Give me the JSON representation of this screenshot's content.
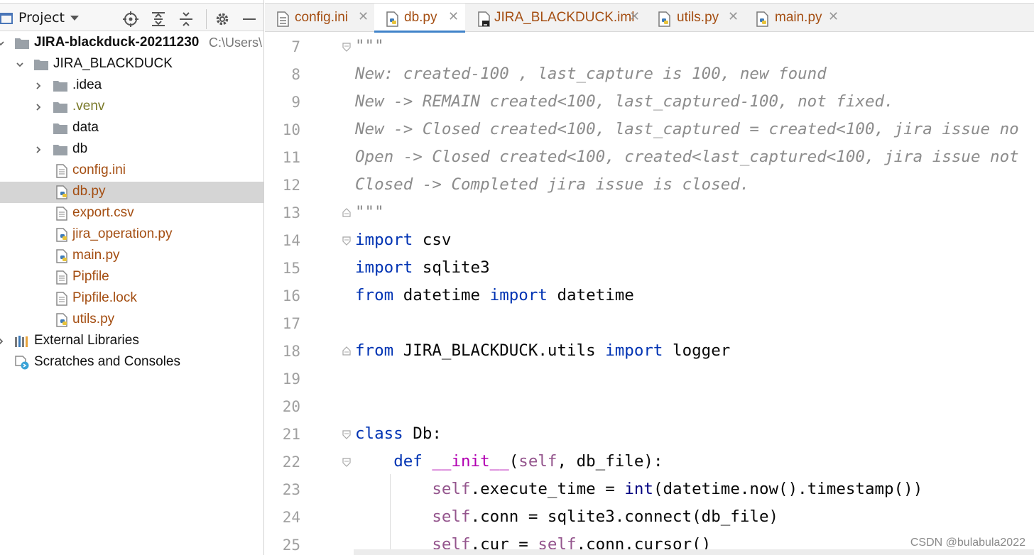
{
  "project_panel": {
    "title": "Project",
    "toolbar_icons": [
      "locate-icon",
      "expand-all-icon",
      "collapse-all-icon",
      "gear-icon",
      "minimize-icon"
    ],
    "tree": [
      {
        "label": "JIRA-blackduck-20211230",
        "path": "C:\\Users\\",
        "type": "root",
        "color": "#111111"
      },
      {
        "label": "JIRA_BLACKDUCK",
        "type": "folder",
        "color": "#111111"
      },
      {
        "label": ".idea",
        "type": "folder",
        "color": "#111111"
      },
      {
        "label": ".venv",
        "type": "folder",
        "color": "#7a7a2a"
      },
      {
        "label": "data",
        "type": "folder",
        "color": "#111111"
      },
      {
        "label": "db",
        "type": "folder",
        "color": "#111111"
      },
      {
        "label": "config.ini",
        "type": "file",
        "color": "#a44e12"
      },
      {
        "label": "db.py",
        "type": "python",
        "color": "#a44e12",
        "selected": true
      },
      {
        "label": "export.csv",
        "type": "file",
        "color": "#a44e12"
      },
      {
        "label": "jira_operation.py",
        "type": "python",
        "color": "#a44e12"
      },
      {
        "label": "main.py",
        "type": "python",
        "color": "#a44e12"
      },
      {
        "label": "Pipfile",
        "type": "file",
        "color": "#a44e12"
      },
      {
        "label": "Pipfile.lock",
        "type": "file",
        "color": "#a44e12"
      },
      {
        "label": "utils.py",
        "type": "python",
        "color": "#a44e12"
      },
      {
        "label": "External Libraries",
        "type": "libraries",
        "color": "#111111"
      },
      {
        "label": "Scratches and Consoles",
        "type": "scratches",
        "color": "#111111"
      }
    ]
  },
  "tabs": [
    {
      "label": "config.ini",
      "icon": "ini-file-icon",
      "active": false
    },
    {
      "label": "db.py",
      "icon": "python-file-icon",
      "active": true
    },
    {
      "label": "JIRA_BLACKDUCK.iml",
      "icon": "iml-file-icon",
      "active": false
    },
    {
      "label": "utils.py",
      "icon": "python-file-icon",
      "active": false
    },
    {
      "label": "main.py",
      "icon": "python-file-icon",
      "active": false
    }
  ],
  "tab_close_glyph": "✕",
  "editor": {
    "lines": [
      {
        "n": "7",
        "html": "<span class='doc'>\"\"\"</span>"
      },
      {
        "n": "8",
        "html": "<span class='doc'>New: created-100 , last_capture is 100, new found</span>"
      },
      {
        "n": "9",
        "html": "<span class='doc'>New -&gt; REMAIN created&lt;100, last_captured-100, not fixed.</span>"
      },
      {
        "n": "10",
        "html": "<span class='doc'>New -&gt; Closed created&lt;100, last_captured = created&lt;100, jira issue no</span>"
      },
      {
        "n": "11",
        "html": "<span class='doc'>Open -&gt; Closed created&lt;100, created&lt;last_captured&lt;100, jira issue not</span>"
      },
      {
        "n": "12",
        "html": "<span class='doc'>Closed -&gt; Completed jira issue is closed.</span>"
      },
      {
        "n": "13",
        "html": "<span class='doc'>\"\"\"</span>"
      },
      {
        "n": "14",
        "html": "<span class='kw'>import</span> csv"
      },
      {
        "n": "15",
        "html": "<span class='kw'>import</span> sqlite3"
      },
      {
        "n": "16",
        "html": "<span class='kw'>from</span> datetime <span class='kw'>import</span> datetime"
      },
      {
        "n": "17",
        "html": ""
      },
      {
        "n": "18",
        "html": "<span class='kw'>from</span> JIRA_BLACKDUCK.utils <span class='kw'>import</span> logger"
      },
      {
        "n": "19",
        "html": ""
      },
      {
        "n": "20",
        "html": ""
      },
      {
        "n": "21",
        "html": "<span class='kw'>class</span> Db:"
      },
      {
        "n": "22",
        "html": "    <span class='kw'>def</span> <span class='magic'>__init__</span>(<span class='selfk'>self</span>, db_file):"
      },
      {
        "n": "23",
        "html": "        <span class='selfk'>self</span>.execute_time = <span class='builtin'>int</span>(datetime.now().timestamp())"
      },
      {
        "n": "24",
        "html": "        <span class='selfk'>self</span>.conn = sqlite3.connect(db_file)"
      },
      {
        "n": "25",
        "html": "        <span class='selfk'>self</span>.cur = <span class='selfk'>self</span>.conn.cursor()"
      }
    ]
  },
  "watermark": "CSDN @bulabula2022"
}
